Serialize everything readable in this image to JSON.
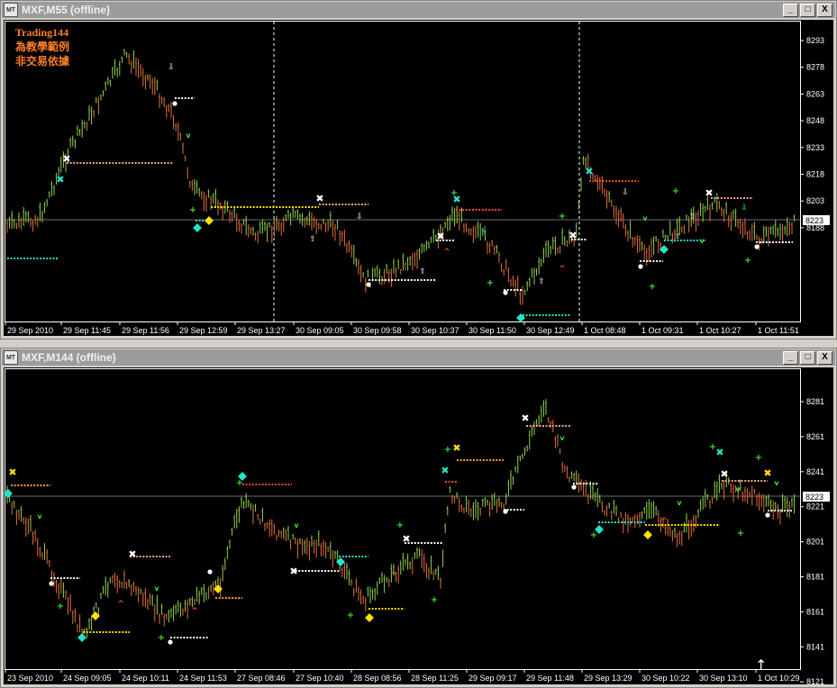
{
  "colors": {
    "up": "#8fd14f",
    "down": "#e07040",
    "grid": "#ffffff",
    "price_line": "#6b6b6b",
    "cyan": "#22e6c8",
    "salmon": "#f2a48a",
    "white": "#ffffff",
    "yellow": "#ffe000",
    "orange": "#ff9f2a",
    "red": "#ff4a2a",
    "lime": "#39e039"
  },
  "windows": [
    {
      "title": "MXF,M55 (offline)",
      "icon_label": "MT",
      "buttons": {
        "minimize": "_",
        "maximize": "□",
        "close": "X"
      },
      "notes": [
        "Trading144",
        "為教學範例",
        "非交易依據"
      ],
      "price_axis": [
        "8293",
        "8278",
        "8263",
        "8248",
        "8233",
        "8218",
        "8203",
        "8188"
      ],
      "current_price": "8223",
      "time_axis": [
        "29 Sep 2010",
        "29 Sep 11:45",
        "29 Sep 11:56",
        "29 Sep 12:59",
        "29 Sep 13:27",
        "30 Sep 09:05",
        "30 Sep 09:58",
        "30 Sep 10:37",
        "30 Sep 11:50",
        "30 Sep 12:49",
        "1 Oct 08:48",
        "1 Oct 09:31",
        "1 Oct 10:27",
        "1 Oct 11:51"
      ]
    },
    {
      "title": "MXF,M144 (offline)",
      "icon_label": "MT",
      "buttons": {
        "minimize": "_",
        "maximize": "□",
        "close": "X"
      },
      "price_axis": [
        "8281",
        "8261",
        "8241",
        "8221",
        "8201",
        "8181",
        "8161",
        "8141",
        "8121"
      ],
      "current_price": "8223",
      "time_axis": [
        "23 Sep 2010",
        "24 Sep 09:05",
        "24 Sep 10:11",
        "24 Sep 11:53",
        "27 Sep 08:46",
        "27 Sep 10:40",
        "28 Sep 08:56",
        "28 Sep 11:25",
        "29 Sep 09:17",
        "29 Sep 11:48",
        "29 Sep 13:29",
        "30 Sep 10:22",
        "30 Sep 13:10",
        "1 Oct 10:29"
      ]
    }
  ]
}
